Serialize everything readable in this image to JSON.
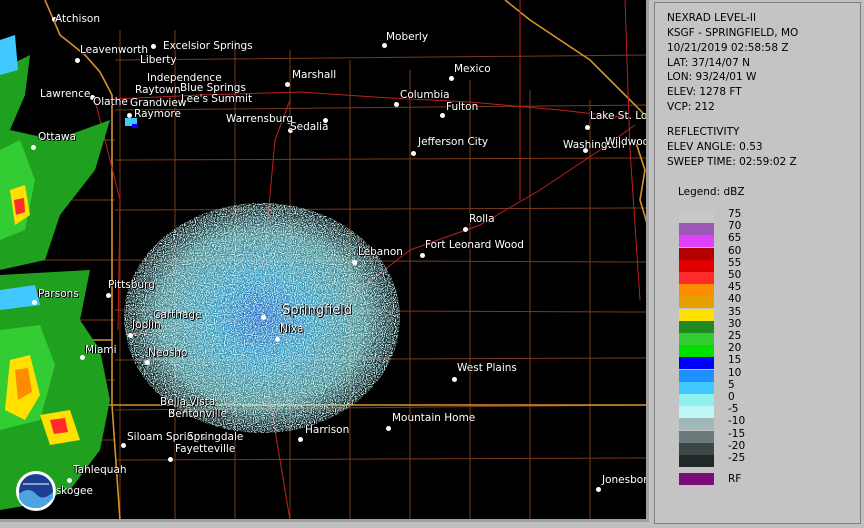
{
  "product": {
    "title": "NEXRAD LEVEL-II",
    "station": "KSGF - SPRINGFIELD, MO",
    "datetime": "10/21/2019 02:58:58 Z",
    "lat": "LAT: 37/14/07 N",
    "lon": "LON: 93/24/01 W",
    "elev": "ELEV: 1278 FT",
    "vcp": "VCP: 212",
    "field": "REFLECTIVITY",
    "elev_angle": "ELEV ANGLE: 0.53",
    "sweep_time": "SWEEP TIME: 02:59:02 Z"
  },
  "legend": {
    "title": "Legend: dBZ",
    "levels": [
      {
        "label": "75",
        "color": "#c8c8c8"
      },
      {
        "label": "70",
        "color": "#9b59b6"
      },
      {
        "label": "65",
        "color": "#e040fb"
      },
      {
        "label": "60",
        "color": "#b20000"
      },
      {
        "label": "55",
        "color": "#e00000"
      },
      {
        "label": "50",
        "color": "#ff2a2a"
      },
      {
        "label": "45",
        "color": "#ff8c00"
      },
      {
        "label": "40",
        "color": "#e8a000"
      },
      {
        "label": "35",
        "color": "#ffe000"
      },
      {
        "label": "30",
        "color": "#1f8a1f"
      },
      {
        "label": "25",
        "color": "#33cc33"
      },
      {
        "label": "20",
        "color": "#00e000"
      },
      {
        "label": "15",
        "color": "#0000ff"
      },
      {
        "label": "10",
        "color": "#1e90ff"
      },
      {
        "label": "5",
        "color": "#40c8ff"
      },
      {
        "label": "0",
        "color": "#8ff0f0"
      },
      {
        "label": "-5",
        "color": "#c0f8f8"
      },
      {
        "label": "-10",
        "color": "#a0b8b8"
      },
      {
        "label": "-15",
        "color": "#6a7a7a"
      },
      {
        "label": "-20",
        "color": "#3c4848"
      },
      {
        "label": "-25",
        "color": "#202828"
      }
    ],
    "rf_label": "RF",
    "rf_color": "#7a0d7a"
  },
  "cities": [
    "Atchison",
    "Excelsior Springs",
    "Leavenworth",
    "Liberty",
    "Independence",
    "Blue Springs",
    "Raytown",
    "Lee's Summit",
    "Lawrence",
    "Olathe",
    "Grandview",
    "Raymore",
    "Ottawa",
    "Moberly",
    "Mexico",
    "Marshall",
    "Columbia",
    "Fulton",
    "Warrensburg",
    "Sedalia",
    "Jefferson City",
    "Lake St. Louis",
    "Washington",
    "Wildwood",
    "Rolla",
    "Fort Leonard Wood",
    "Lebanon",
    "Pittsburg",
    "Parsons",
    "Carthage",
    "Joplin",
    "Springfield",
    "Nixa",
    "Neosho",
    "Miami",
    "West Plains",
    "Bella Vista",
    "Bentonville",
    "Mountain Home",
    "Siloam Springs",
    "Springdale",
    "Harrison",
    "Fayetteville",
    "Tahlequah",
    "Muskogee",
    "Jonesboro"
  ]
}
